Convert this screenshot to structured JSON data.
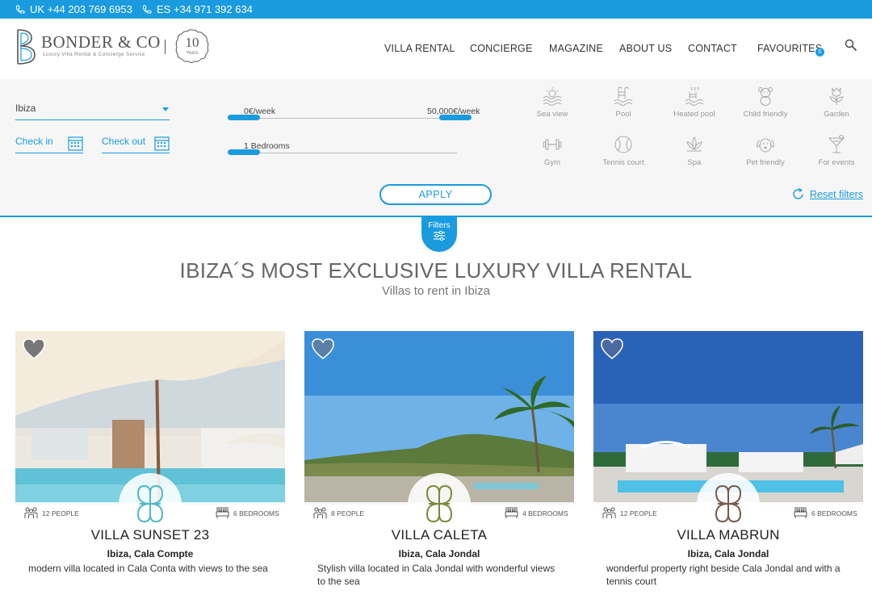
{
  "topbar": {
    "phone_uk": "UK +44 203 769 6953",
    "phone_es": "ES +34 971 392 634"
  },
  "brand": {
    "name": "BONDER & CO",
    "tagline": "Luxury Villa Rental & Concierge Service",
    "badge_num": "10",
    "badge_years": "Years"
  },
  "nav": {
    "items": [
      "VILLA RENTAL",
      "CONCIERGE",
      "MAGAZINE",
      "ABOUT US",
      "CONTACT",
      "FAVOURITES"
    ],
    "favourites_count": "0"
  },
  "filters": {
    "destination": "Ibiza",
    "check_in": "Check in",
    "check_out": "Check out",
    "price_min": "0€/week",
    "price_max": "50,000€/week",
    "bedrooms": "1 Bedrooms",
    "amenities": [
      "Sea view",
      "Pool",
      "Heated pool",
      "Child friendly",
      "Garden",
      "Gym",
      "Tennis court",
      "Spa",
      "Pet friendly",
      "For events"
    ],
    "apply": "APPLY",
    "reset": "Reset filters",
    "tab_label": "Filters"
  },
  "hero": {
    "title": "IBIZA´S MOST EXCLUSIVE LUXURY VILLA RENTAL",
    "subtitle": "Villas to rent in Ibiza"
  },
  "villas": [
    {
      "name": "VILLA SUNSET 23",
      "people": "12 PEOPLE",
      "bedrooms": "6 BEDROOMS",
      "location": "Ibiza, Cala Compte",
      "description": "modern villa located in Cala Conta with views to the sea"
    },
    {
      "name": "VILLA CALETA",
      "people": "8 PEOPLE",
      "bedrooms": "4 BEDROOMS",
      "location": "Ibiza, Cala Jondal",
      "description": "Stylish villa located in Cala Jondal with wonderful views to the sea"
    },
    {
      "name": "VILLA MABRUN",
      "people": "12 PEOPLE",
      "bedrooms": "6 BEDROOMS",
      "location": "Ibiza, Cala Jondal",
      "description": "wonderful property right beside Cala Jondal and with a tennis court"
    }
  ],
  "colors": {
    "accent": "#1a9be0"
  }
}
